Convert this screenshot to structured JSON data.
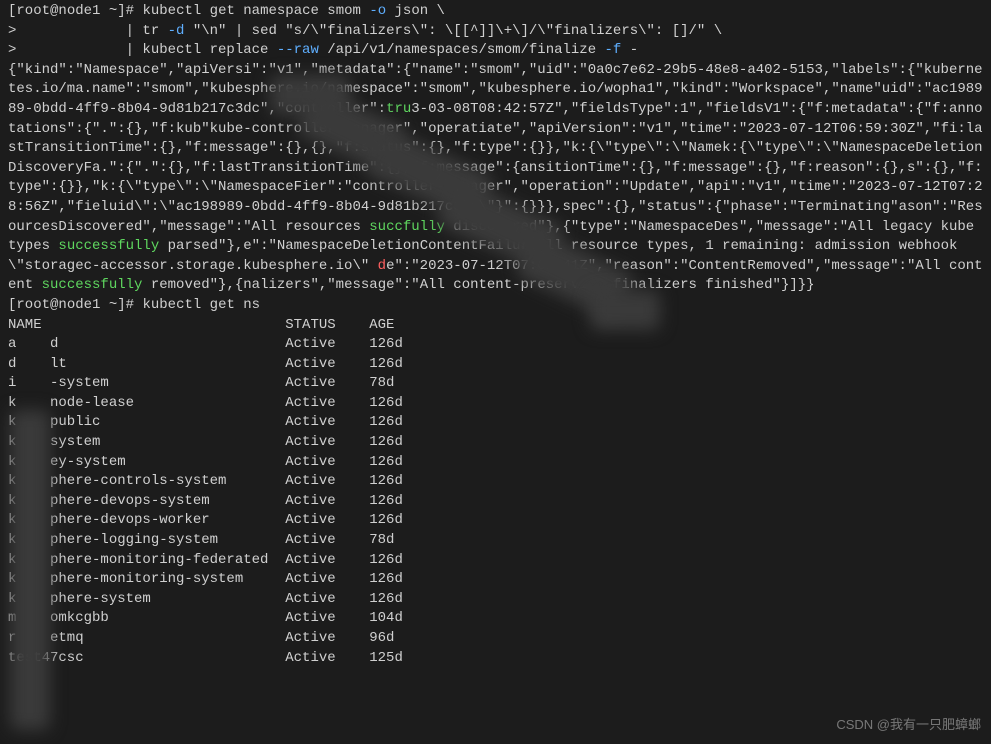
{
  "prompt": {
    "user": "root",
    "host": "node1",
    "path": "~",
    "symbol": "#"
  },
  "cmd1": {
    "part1": "kubectl get namespace smom ",
    "opt1": "-o",
    "part2": " json ",
    "cont": "\\",
    "line2a": ">             | tr ",
    "opt2": "-d",
    "line2b": " \"\\n\" | sed \"s/\\\"finalizers\\\": \\[[^]]\\+\\]/\\\"finalizers\\\": []/\" \\",
    "line3a": ">             | kubectl replace ",
    "opt3": "--raw",
    "line3b": " /api/v1/namespaces/smom/finalize ",
    "opt4": "-f",
    "line3c": " -"
  },
  "json_segments": [
    {
      "t": "{\"kind\":\"Namespace\",\"apiVersi"
    },
    {
      "t": "\":\"v1\",\"metadata\":{\"name\":\"smom\",\"uid\":\"0a0c7e62-29b5-48e8-a402-5153"
    },
    {
      "t": ",\"labels\":{\"kubernetes.io/m"
    },
    {
      "t": "a.name\":\"smom\",\"kubesphere.io/namespace\":\"smom\",\"kubesphere.io/wo"
    },
    {
      "t": "pha1\",\"kind\":\"Workspace\",\"name"
    },
    {
      "t": "\"uid\":\"ac198989-0bdd-4ff9-8b04-9d81b217c3dc\",\"controller\":"
    },
    {
      "t": "tru",
      "cls": "true"
    },
    {
      "t": "3-03-08T08:42:57Z\",\"fieldsType\":"
    },
    {
      "t": "1\",\"fieldsV1\":{\"f:metadata\":{\"f:annotations\":{\".\":{},\"f:kub"
    },
    {
      "t": "\"kube-controller-manager\",\"operati"
    },
    {
      "t": "ate\",\"apiVersion\":\"v1\",\"time\":\"2023-07-12T06:59:30Z\",\"fi"
    },
    {
      "t": ":lastTransitionTime\":{},\"f:message\":{},"
    },
    {
      "t": "{},\"f:status\":{},\"f:type\":{}},\"k:{\\\"type\\\":\\\"Name"
    },
    {
      "t": "k:{\\\"type\\\":\\\"NamespaceDeletionDiscoveryFa."
    },
    {
      "t": "\":{\".\":{},\"f:lastTransitionTime\":{},\"f:message\":{"
    },
    {
      "t": "ansitionTime\":{},\"f:message\":{},\"f:reason\":{},"
    },
    {
      "t": "s\":{},\"f:type\":{}},\"k:{\\\"type\\\":\\\"NamespaceFi"
    },
    {
      "t": "er\":\"controller-manager\",\"operation\":\"Update\",\"api"
    },
    {
      "t": "\":\"v1\",\"time\":\"2023-07-12T07:28:56Z\",\"fiel"
    },
    {
      "t": "uid\\\":\\\"ac198989-0bdd-4ff9-8b04-9d81b217c3dc\\\"}\":{}}},"
    },
    {
      "t": "spec\":{},\"status\":{\"phase\":\"Terminating\""
    },
    {
      "t": "ason\":\"ResourcesDiscovered\",\"message\":\"All resources "
    },
    {
      "t": "succ",
      "cls": "success"
    },
    {
      "t": "fully",
      "cls": "success"
    },
    {
      "t": " discovered\"},{\"type\":\"NamespaceDe"
    },
    {
      "t": "s\",\"message\":\"All legacy kube types "
    },
    {
      "t": "successfully",
      "cls": "success"
    },
    {
      "t": " parsed\"},"
    },
    {
      "t": "e\":\"NamespaceDeletionContentFailure\""
    },
    {
      "t": "ll resource types, 1 remaining: admission webhook \\\"storagec"
    },
    {
      "t": "-accessor.storage.kubesphere.io\\\" "
    },
    {
      "t": "d",
      "cls": "err"
    },
    {
      "t": "e\":\"2023-07-12T07:02:41Z\",\"reason\":\"ContentRemoved\",\"message\":\"All content "
    },
    {
      "t": "successfully",
      "cls": "success"
    },
    {
      "t": " removed\"},{"
    },
    {
      "t": "nalizers\",\"message\":\"All content-preserving finalizers finished\"}]}}"
    }
  ],
  "cmd2": "kubectl get ns",
  "table": {
    "header": {
      "name": "NAME",
      "status": "STATUS",
      "age": "AGE"
    },
    "rows": [
      {
        "name": "a    d",
        "status": "Active",
        "age": "126d"
      },
      {
        "name": "d    lt",
        "status": "Active",
        "age": "126d"
      },
      {
        "name": "i    -system",
        "status": "Active",
        "age": "78d"
      },
      {
        "name": "k    node-lease",
        "status": "Active",
        "age": "126d"
      },
      {
        "name": "k    public",
        "status": "Active",
        "age": "126d"
      },
      {
        "name": "k    system",
        "status": "Active",
        "age": "126d"
      },
      {
        "name": "k    ey-system",
        "status": "Active",
        "age": "126d"
      },
      {
        "name": "k    phere-controls-system",
        "status": "Active",
        "age": "126d"
      },
      {
        "name": "k    phere-devops-system",
        "status": "Active",
        "age": "126d"
      },
      {
        "name": "k    phere-devops-worker",
        "status": "Active",
        "age": "126d"
      },
      {
        "name": "k    phere-logging-system",
        "status": "Active",
        "age": "78d"
      },
      {
        "name": "k    phere-monitoring-federated",
        "status": "Active",
        "age": "126d"
      },
      {
        "name": "k    phere-monitoring-system",
        "status": "Active",
        "age": "126d"
      },
      {
        "name": "k    phere-system",
        "status": "Active",
        "age": "126d"
      },
      {
        "name": "m    omkcgbb",
        "status": "Active",
        "age": "104d"
      },
      {
        "name": "r    etmq",
        "status": "Active",
        "age": "96d"
      },
      {
        "name": "test47csc",
        "status": "Active",
        "age": "125d"
      }
    ]
  },
  "watermark": "CSDN @我有一只肥蟑螂"
}
